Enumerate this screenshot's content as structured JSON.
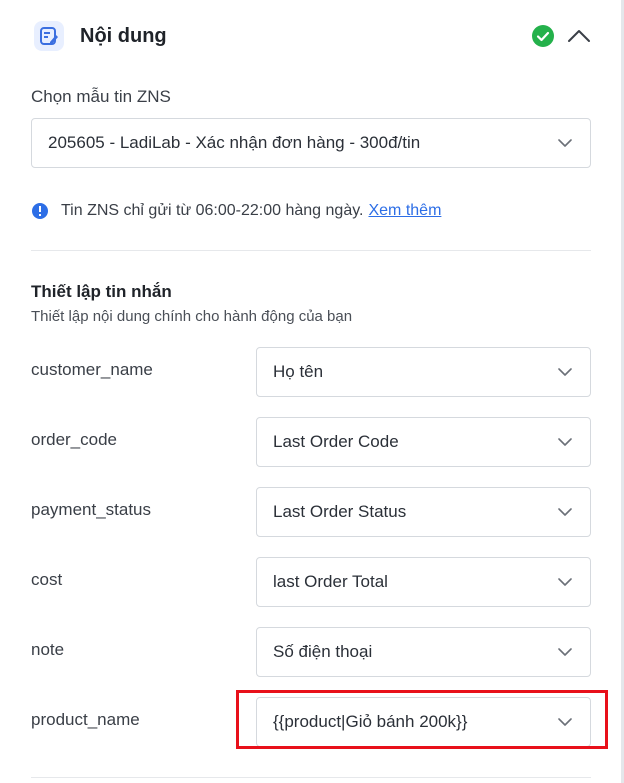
{
  "header": {
    "title": "Nội dung",
    "icon": "edit-note-icon",
    "status_icon": "check-circle-icon",
    "status_color": "#24b14b",
    "collapse_icon": "chevron-up-icon"
  },
  "template": {
    "label": "Chọn mẫu tin ZNS",
    "value": "205605 - LadiLab - Xác nhận đơn hàng - 300đ/tin"
  },
  "info": {
    "text": "Tin ZNS chỉ gửi từ 06:00-22:00 hàng ngày.",
    "link": "Xem thêm",
    "icon": "info-circle-icon",
    "color": "#2d6ee6"
  },
  "settings": {
    "title": "Thiết lập tin nhắn",
    "subtitle": "Thiết lập nội dung chính cho hành động của bạn",
    "fields": [
      {
        "name": "customer_name",
        "value": "Họ tên"
      },
      {
        "name": "order_code",
        "value": "Last Order Code"
      },
      {
        "name": "payment_status",
        "value": "Last Order Status"
      },
      {
        "name": "cost",
        "value": "last Order Total"
      },
      {
        "name": "note",
        "value": "Số điện thoại"
      },
      {
        "name": "product_name",
        "value": "{{product|Giỏ bánh 200k}}"
      }
    ]
  },
  "highlight_color": "#e8101a"
}
